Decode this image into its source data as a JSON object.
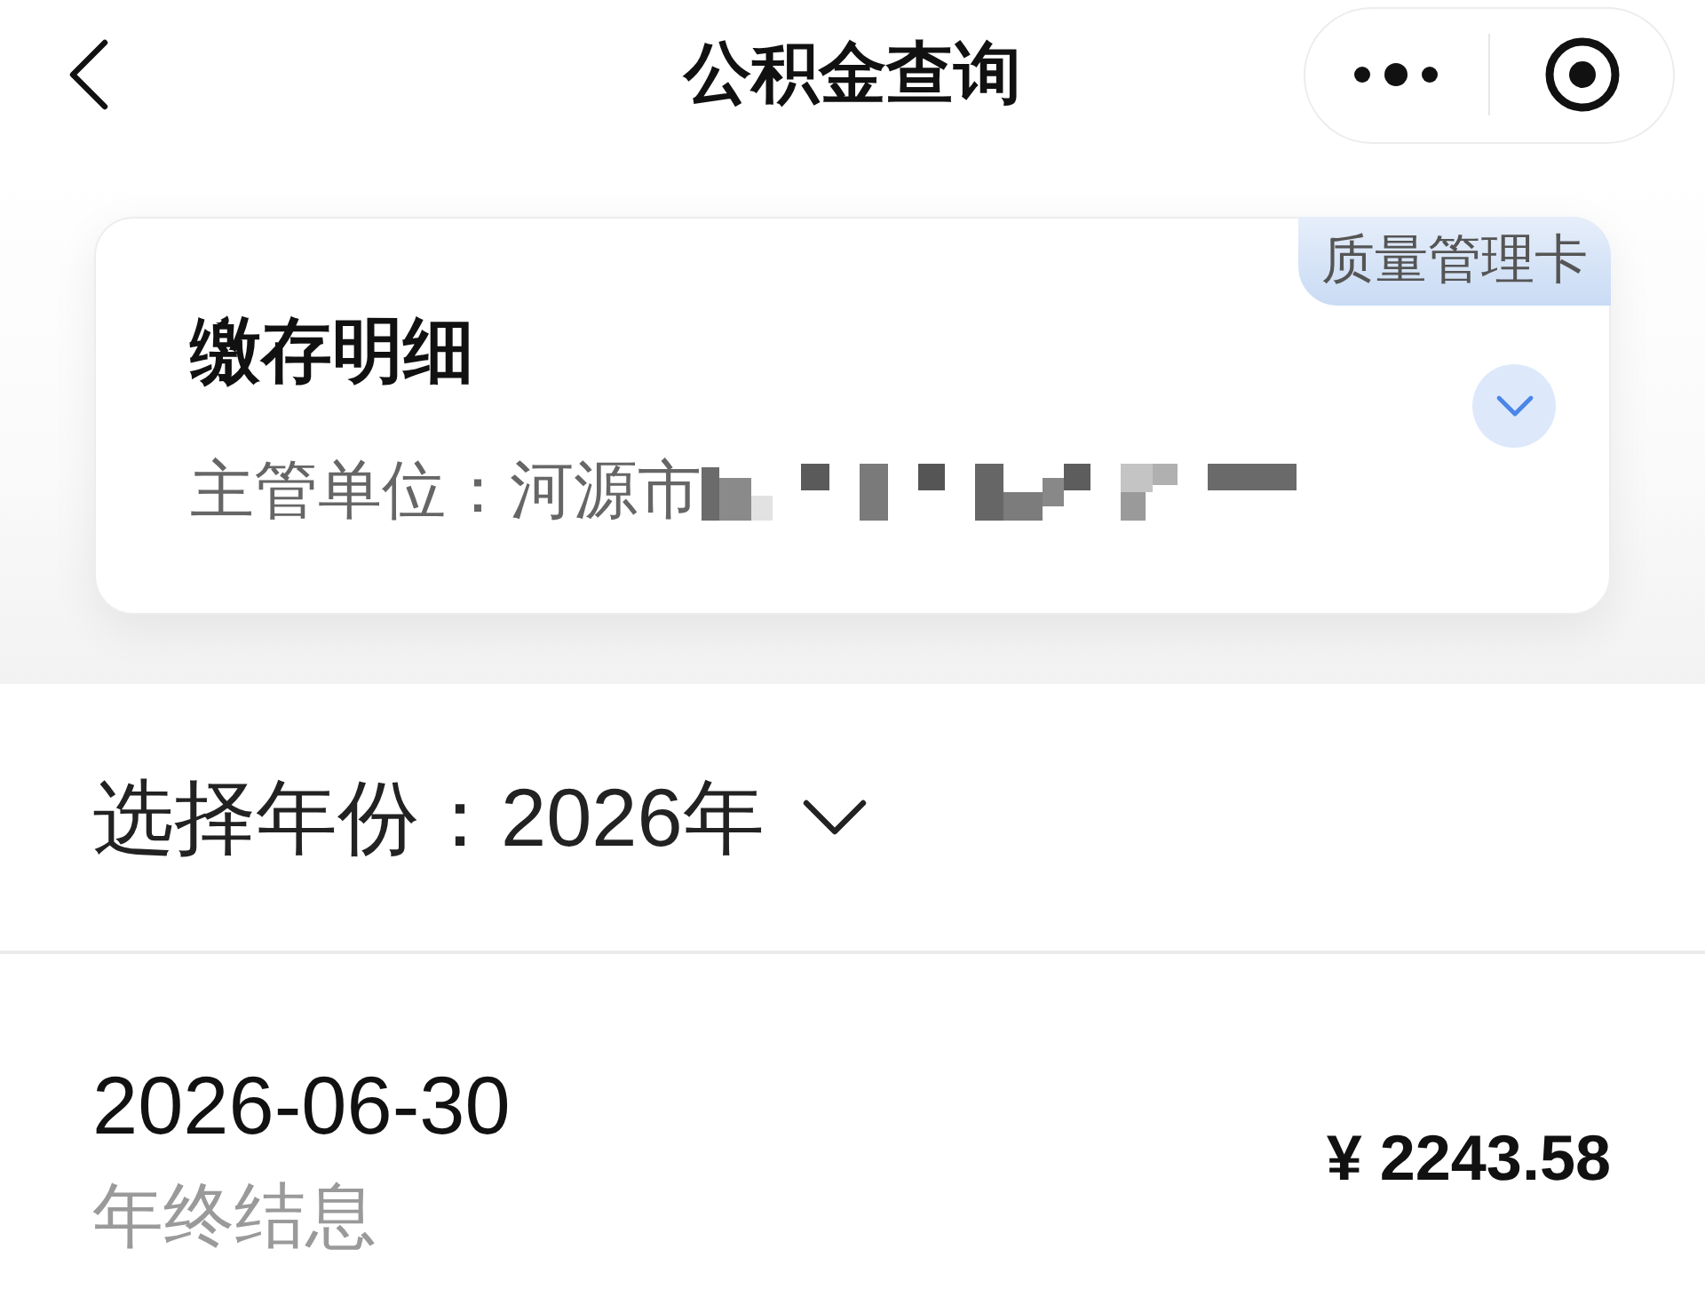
{
  "nav_bar": {
    "title": "公积金查询"
  },
  "card": {
    "tag": "质量管理卡",
    "title": "缴存明细",
    "subtitle": "主管单位：河源市",
    "expanded": false
  },
  "year_picker": {
    "label": "选择年份：",
    "value": "2026年"
  },
  "records": [
    {
      "date": "2026-06-30",
      "type": "年终结息",
      "amount": "¥ 2243.58"
    }
  ]
}
